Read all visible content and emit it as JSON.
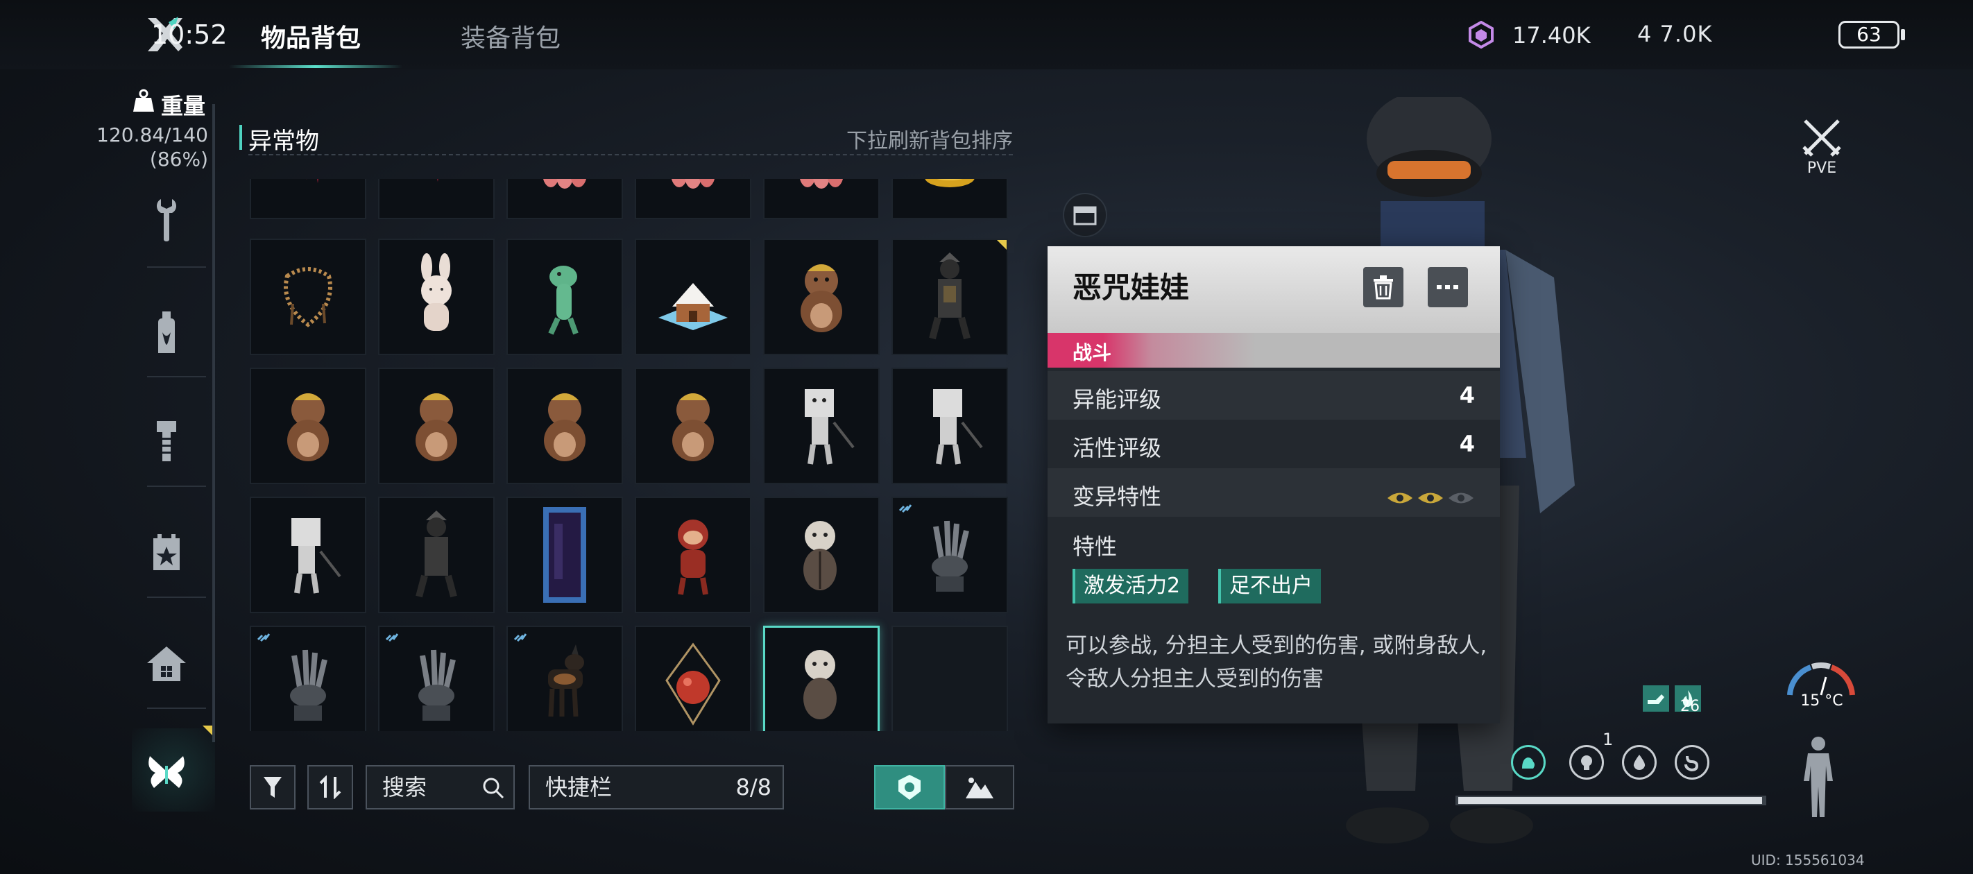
{
  "status_bar": {
    "time": "10:52",
    "currency": "17.40K",
    "status_text": "4 7.0K",
    "battery": "63"
  },
  "tabs": {
    "items": "物品背包",
    "equipment": "装备背包"
  },
  "sidebar": {
    "weight_label": "重量",
    "weight_value": "120.84/140",
    "weight_percent": "(86%)",
    "icons": [
      "wrench-icon",
      "bottle-icon",
      "bolt-icon",
      "calendar-star-icon",
      "home-icon",
      "butterfly-icon"
    ]
  },
  "inventory": {
    "section_title": "异常物",
    "section_hint": "下拉刷新背包排序",
    "search_placeholder": "搜索",
    "hotbar_label": "快捷栏",
    "hotbar_count": "8/8"
  },
  "pve_label": "PVE",
  "popup": {
    "title": "恶咒娃娃",
    "tag": "战斗",
    "rows": [
      {
        "label": "异能评级",
        "value": "4"
      },
      {
        "label": "活性评级",
        "value": "4"
      },
      {
        "label": "变异特性",
        "value": ""
      }
    ],
    "traits_label": "特性",
    "traits": [
      "激发活力2",
      "足不出户"
    ],
    "description": "可以参战, 分担主人受到的伤害, 或附身敌人, 令敌人分担主人受到的伤害"
  },
  "hud": {
    "badge_count": "26",
    "status_count": "1",
    "temperature": "15 °C",
    "uid": "UID: 155561034"
  }
}
